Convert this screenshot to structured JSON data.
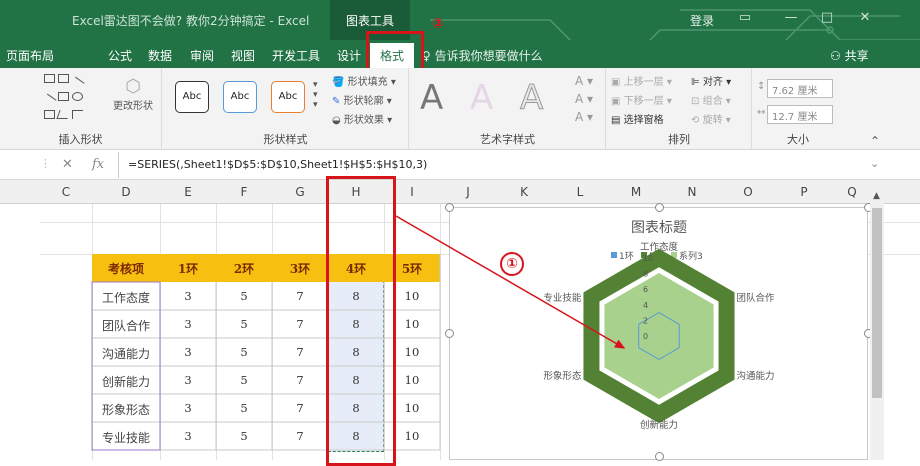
{
  "window": {
    "title": "Excel雷达图不会做? 教你2分钟搞定 - Excel",
    "contextual_tab_group": "图表工具",
    "signin": "登录",
    "share": "共享"
  },
  "ribbon_tabs": [
    {
      "label": "页面布局"
    },
    {
      "label": "公式"
    },
    {
      "label": "数据"
    },
    {
      "label": "审阅"
    },
    {
      "label": "视图"
    },
    {
      "label": "开发工具"
    },
    {
      "label": "设计"
    },
    {
      "label": "格式"
    }
  ],
  "tell_me": "告诉我你想要做什么",
  "callout_markers": {
    "format_tab": "②",
    "chart_series": "①"
  },
  "ribbon_groups": {
    "insert_shapes": {
      "label": "插入形状",
      "change_shape": "更改形状"
    },
    "shape_styles": {
      "label": "形状样式",
      "style_text": "Abc",
      "fill": "形状填充",
      "outline": "形状轮廓",
      "effects": "形状效果"
    },
    "wordart_styles": {
      "label": "艺术字样式",
      "sample": "A"
    },
    "arrange": {
      "label": "排列",
      "bring_forward": "上移一层",
      "send_backward": "下移一层",
      "selection_pane": "选择窗格",
      "align": "对齐",
      "group": "组合",
      "rotate": "旋转"
    },
    "size": {
      "label": "大小",
      "height": "7.62 厘米",
      "width": "12.7 厘米"
    }
  },
  "formula_bar": {
    "fx": "fx",
    "cancel": "✕",
    "enter": "✓",
    "formula": "=SERIES(,Sheet1!$D$5:$D$10,Sheet1!$H$5:$H$10,3)"
  },
  "columns": [
    "C",
    "D",
    "E",
    "F",
    "G",
    "H",
    "I",
    "J",
    "K",
    "L",
    "M",
    "N",
    "O",
    "P",
    "Q"
  ],
  "table": {
    "headers": [
      "考核项",
      "1环",
      "2环",
      "3环",
      "4环",
      "5环"
    ],
    "rows": [
      {
        "item": "工作态度",
        "v": [
          "3",
          "5",
          "7",
          "8",
          "10"
        ]
      },
      {
        "item": "团队合作",
        "v": [
          "3",
          "5",
          "7",
          "8",
          "10"
        ]
      },
      {
        "item": "沟通能力",
        "v": [
          "3",
          "5",
          "7",
          "8",
          "10"
        ]
      },
      {
        "item": "创新能力",
        "v": [
          "3",
          "5",
          "7",
          "8",
          "10"
        ]
      },
      {
        "item": "形象形态",
        "v": [
          "3",
          "5",
          "7",
          "8",
          "10"
        ]
      },
      {
        "item": "专业技能",
        "v": [
          "3",
          "5",
          "7",
          "8",
          "10"
        ]
      }
    ]
  },
  "chart_data": {
    "type": "radar",
    "title": "图表标题",
    "categories": [
      "工作态度",
      "团队合作",
      "沟通能力",
      "创新能力",
      "形象形态",
      "专业技能"
    ],
    "axis_ticks": [
      "0",
      "2",
      "4",
      "6",
      "8",
      "10"
    ],
    "series": [
      {
        "name": "1环",
        "values": [
          3,
          3,
          3,
          3,
          3,
          3
        ],
        "color": "#5b9bd5"
      },
      {
        "name": "5环",
        "values": [
          10,
          10,
          10,
          10,
          10,
          10
        ],
        "color": "#548235"
      },
      {
        "name": "系列3",
        "values": [
          8,
          8,
          8,
          8,
          8,
          8
        ],
        "color": "#a9d18e"
      }
    ],
    "legend_position": "top",
    "ylim": [
      0,
      10
    ]
  },
  "colors": {
    "excel_green": "#217346",
    "header_fill": "#f7bf10",
    "highlight_red": "#d8141b"
  }
}
